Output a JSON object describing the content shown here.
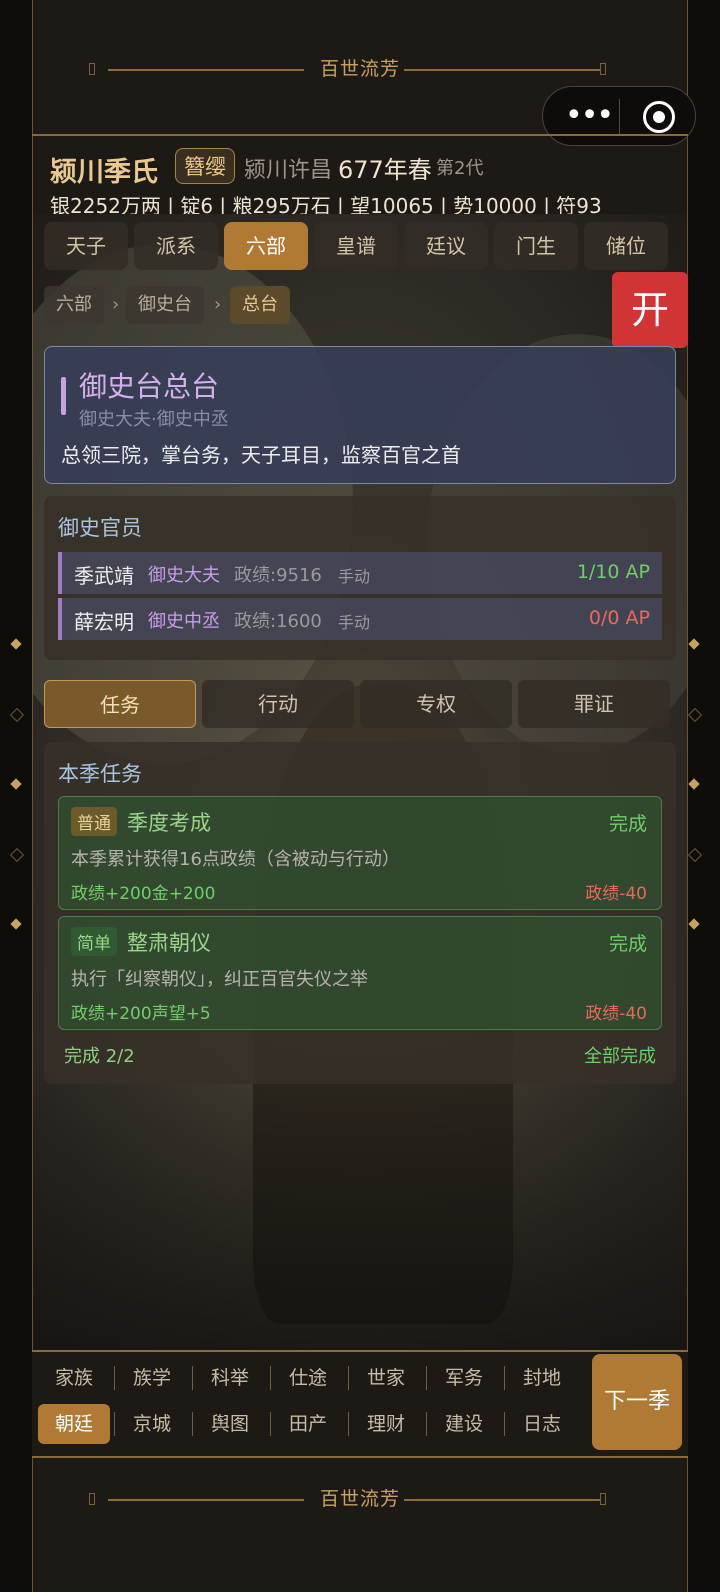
{
  "banner": {
    "title": "百世流芳"
  },
  "capsule": {
    "more_icon": "dots-icon",
    "close_icon": "target-icon"
  },
  "header": {
    "clan": "颍川季氏",
    "title": "簪缨",
    "location": "颍川许昌",
    "season": "677年春",
    "generation": "第2代",
    "resources": "银2252万两 | 锭6 | 粮295万石 | 望10065 | 势10000 | 符93"
  },
  "tabs": [
    "天子",
    "派系",
    "六部",
    "皇谱",
    "廷议",
    "门生",
    "储位"
  ],
  "active_tab": "六部",
  "breadcrumb": [
    "六部",
    "御史台",
    "总台"
  ],
  "open_button": "开",
  "department": {
    "title": "御史台总台",
    "subtitle": "御史大夫·御史中丞",
    "description": "总领三院，掌台务，天子耳目，监察百官之首"
  },
  "officials": {
    "title": "御史官员",
    "rows": [
      {
        "name": "季武靖",
        "role": "御史大夫",
        "merit": "政绩:9516",
        "mode": "手动",
        "ap": "1/10 AP",
        "ap_color": "#6fce6a"
      },
      {
        "name": "薛宏明",
        "role": "御史中丞",
        "merit": "政绩:1600",
        "mode": "手动",
        "ap": "0/0 AP",
        "ap_color": "#e56b5d"
      }
    ]
  },
  "subtabs": [
    "任务",
    "行动",
    "专权",
    "罪证"
  ],
  "active_subtab": "任务",
  "tasks": {
    "title": "本季任务",
    "items": [
      {
        "level": "普通",
        "level_bg": "#6b5a2a",
        "level_color": "#e8d49a",
        "name": "季度考成",
        "status": "完成",
        "desc": "本季累计获得16点政绩（含被动与行动）",
        "reward": "政绩+200金+200",
        "penalty": "政绩-40"
      },
      {
        "level": "简单",
        "level_bg": "#2f5a32",
        "level_color": "#9bd58c",
        "name": "整肃朝仪",
        "status": "完成",
        "desc": "执行「纠察朝仪」，纠正百官失仪之举",
        "reward": "政绩+200声望+5",
        "penalty": "政绩-40"
      }
    ],
    "progress": "完成 2/2",
    "all_done": "全部完成"
  },
  "bottom_nav": {
    "row1": [
      "家族",
      "族学",
      "科举",
      "仕途",
      "世家",
      "军务",
      "封地"
    ],
    "row2": [
      "朝廷",
      "京城",
      "舆图",
      "田产",
      "理财",
      "建设",
      "日志"
    ],
    "active": "朝廷",
    "next": "下一季"
  }
}
